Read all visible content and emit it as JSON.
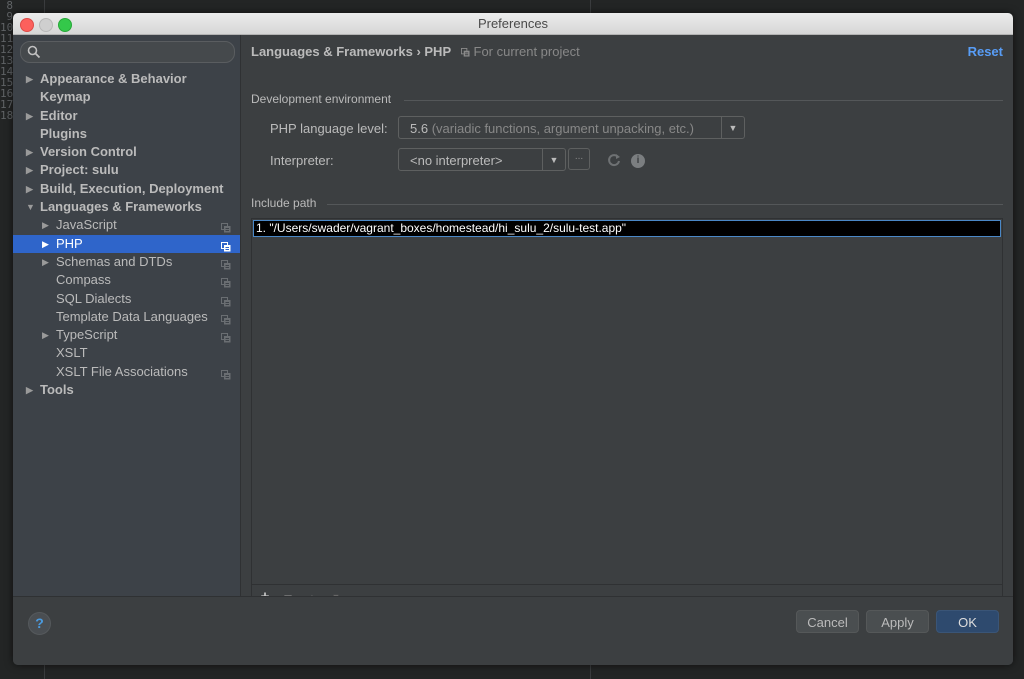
{
  "window": {
    "title": "Preferences"
  },
  "editor_gutter": [
    "8",
    "9",
    "10",
    "11",
    "12",
    "13",
    "14",
    "15",
    "16",
    "17",
    "18"
  ],
  "sidebar": {
    "search": {
      "placeholder": "",
      "value": ""
    },
    "items": [
      {
        "label": "Appearance & Behavior",
        "level": 0,
        "arrow": "collapsed",
        "project": false
      },
      {
        "label": "Keymap",
        "level": 0,
        "arrow": "none",
        "project": false
      },
      {
        "label": "Editor",
        "level": 0,
        "arrow": "collapsed",
        "project": false
      },
      {
        "label": "Plugins",
        "level": 0,
        "arrow": "none",
        "project": false
      },
      {
        "label": "Version Control",
        "level": 0,
        "arrow": "collapsed",
        "project": false
      },
      {
        "label": "Project: sulu",
        "level": 0,
        "arrow": "collapsed",
        "project": false
      },
      {
        "label": "Build, Execution, Deployment",
        "level": 0,
        "arrow": "collapsed",
        "project": false
      },
      {
        "label": "Languages & Frameworks",
        "level": 0,
        "arrow": "expanded",
        "project": false
      },
      {
        "label": "JavaScript",
        "level": 1,
        "arrow": "collapsed",
        "project": true
      },
      {
        "label": "PHP",
        "level": 1,
        "arrow": "collapsed",
        "project": true,
        "selected": true
      },
      {
        "label": "Schemas and DTDs",
        "level": 1,
        "arrow": "collapsed",
        "project": true
      },
      {
        "label": "Compass",
        "level": 1,
        "arrow": "none",
        "project": true
      },
      {
        "label": "SQL Dialects",
        "level": 1,
        "arrow": "none",
        "project": true
      },
      {
        "label": "Template Data Languages",
        "level": 1,
        "arrow": "none",
        "project": true
      },
      {
        "label": "TypeScript",
        "level": 1,
        "arrow": "collapsed",
        "project": true
      },
      {
        "label": "XSLT",
        "level": 1,
        "arrow": "none",
        "project": false
      },
      {
        "label": "XSLT File Associations",
        "level": 1,
        "arrow": "none",
        "project": true
      },
      {
        "label": "Tools",
        "level": 0,
        "arrow": "collapsed",
        "project": false
      }
    ]
  },
  "content": {
    "breadcrumb": "Languages & Frameworks › PHP",
    "scope_label": "For current project",
    "reset_label": "Reset",
    "dev_env_label": "Development environment",
    "php_level_label": "PHP language level:",
    "php_level_value": "5.6",
    "php_level_hint": "(variadic functions, argument unpacking, etc.)",
    "interpreter_label": "Interpreter:",
    "interpreter_value": "<no interpreter>",
    "browse_label": "...",
    "include_path_label": "Include path",
    "include_paths": [
      "1. \"/Users/swader/vagrant_boxes/homestead/hi_sulu_2/sulu-test.app\""
    ],
    "toolbar": {
      "add": "+",
      "remove": "−",
      "up": "▲",
      "down": "▼"
    }
  },
  "footer": {
    "help_label": "?",
    "cancel_label": "Cancel",
    "apply_label": "Apply",
    "ok_label": "OK"
  },
  "colors": {
    "accent": "#2f65ca",
    "link": "#589df6",
    "ok_button": "#2e4a6e"
  }
}
